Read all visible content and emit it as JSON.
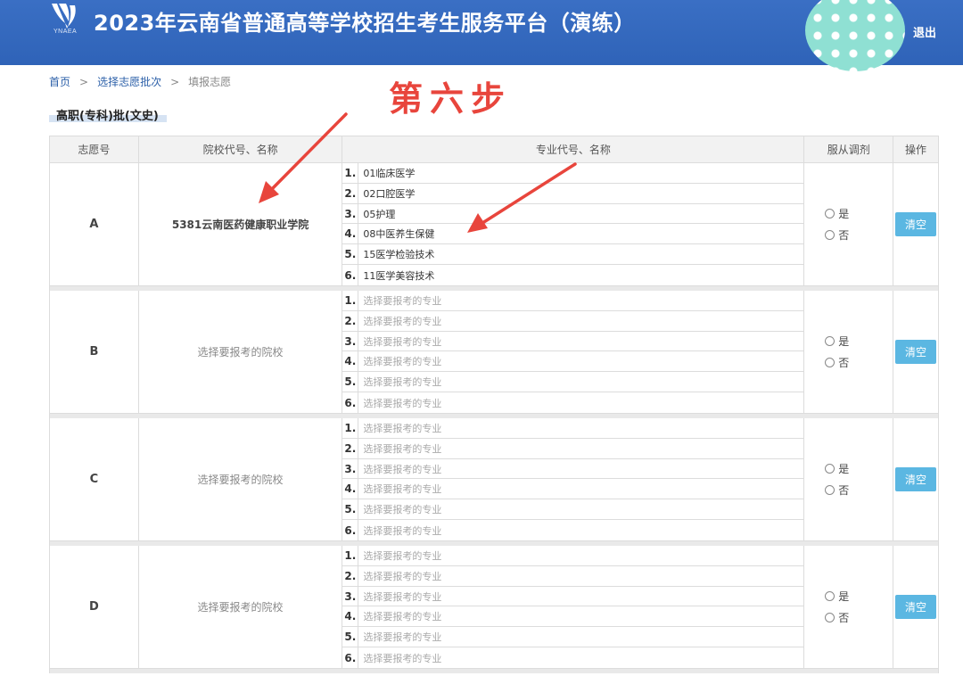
{
  "header": {
    "logo_text": "YNAEA",
    "title": "2023年云南省普通高等学校招生考生服务平台（演练）",
    "logout_label": "退出"
  },
  "breadcrumb": {
    "home": "首页",
    "sep1": ">",
    "batch": "选择志愿批次",
    "sep2": ">",
    "current": "填报志愿"
  },
  "annotation": {
    "step_label": "第六步",
    "color": "#e8453c"
  },
  "batch_title": "高职(专科)批(文史)",
  "table": {
    "headers": [
      "志愿号",
      "院校代号、名称",
      "专业代号、名称",
      "服从调剂",
      "操作"
    ],
    "radio_yes": "是",
    "radio_no": "否",
    "clear_label": "清空",
    "groups": [
      {
        "letter": "A",
        "school": "5381云南医药健康职业学院",
        "majors": [
          {
            "num": "1.",
            "name": "01临床医学"
          },
          {
            "num": "2.",
            "name": "02口腔医学"
          },
          {
            "num": "3.",
            "name": "05护理"
          },
          {
            "num": "4.",
            "name": "08中医养生保健"
          },
          {
            "num": "5.",
            "name": "15医学检验技术"
          },
          {
            "num": "6.",
            "name": "11医学美容技术"
          }
        ]
      },
      {
        "letter": "B",
        "school": "选择要报考的院校",
        "majors": [
          {
            "num": "1.",
            "name": "选择要报考的专业"
          },
          {
            "num": "2.",
            "name": "选择要报考的专业"
          },
          {
            "num": "3.",
            "name": "选择要报考的专业"
          },
          {
            "num": "4.",
            "name": "选择要报考的专业"
          },
          {
            "num": "5.",
            "name": "选择要报考的专业"
          },
          {
            "num": "6.",
            "name": "选择要报考的专业"
          }
        ]
      },
      {
        "letter": "C",
        "school": "选择要报考的院校",
        "majors": [
          {
            "num": "1.",
            "name": "选择要报考的专业"
          },
          {
            "num": "2.",
            "name": "选择要报考的专业"
          },
          {
            "num": "3.",
            "name": "选择要报考的专业"
          },
          {
            "num": "4.",
            "name": "选择要报考的专业"
          },
          {
            "num": "5.",
            "name": "选择要报考的专业"
          },
          {
            "num": "6.",
            "name": "选择要报考的专业"
          }
        ]
      },
      {
        "letter": "D",
        "school": "选择要报考的院校",
        "majors": [
          {
            "num": "1.",
            "name": "选择要报考的专业"
          },
          {
            "num": "2.",
            "name": "选择要报考的专业"
          },
          {
            "num": "3.",
            "name": "选择要报考的专业"
          },
          {
            "num": "4.",
            "name": "选择要报考的专业"
          },
          {
            "num": "5.",
            "name": "选择要报考的专业"
          },
          {
            "num": "6.",
            "name": "选择要报考的专业"
          }
        ]
      }
    ]
  }
}
